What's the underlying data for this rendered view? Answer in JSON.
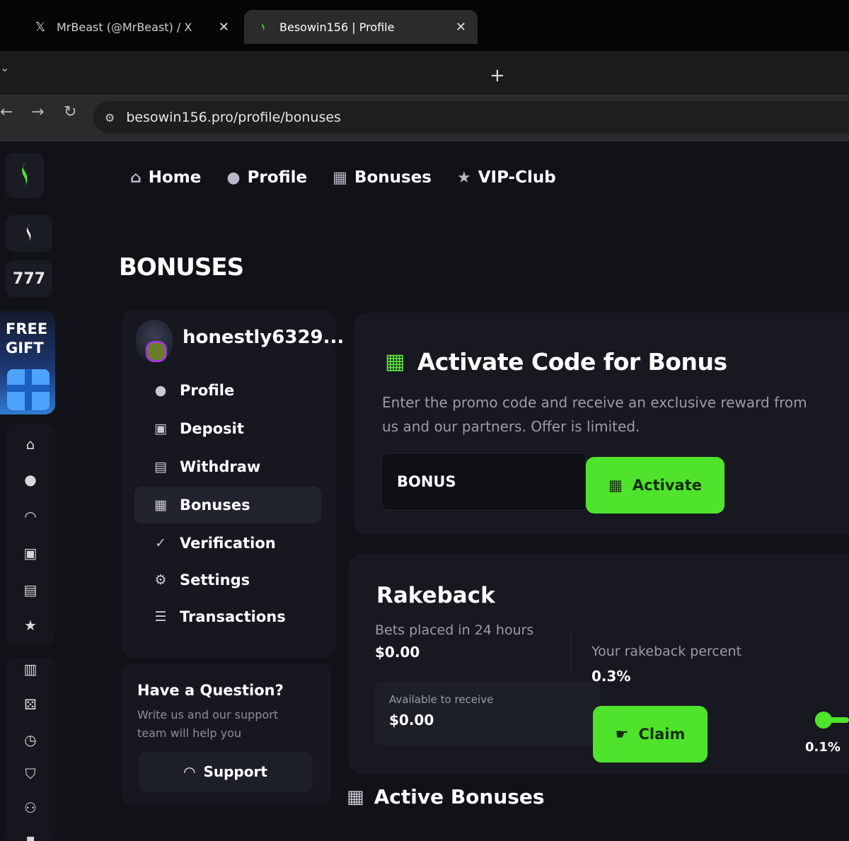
{
  "browser": {
    "tabs": [
      {
        "title": "MrBeast (@MrBeast) / X",
        "icon": "x-logo-icon"
      },
      {
        "title": "Besowin156 | Profile",
        "icon": "besowin-logo-icon"
      }
    ],
    "url": "besowin156.pro/profile/bonuses"
  },
  "rail": {
    "gift_label": "FREE GIFT",
    "slots_label": "777"
  },
  "topnav": [
    {
      "label": "Home",
      "icon": "home-icon"
    },
    {
      "label": "Profile",
      "icon": "user-icon"
    },
    {
      "label": "Bonuses",
      "icon": "gift-icon"
    },
    {
      "label": "VIP-Club",
      "icon": "star-icon"
    }
  ],
  "page_title": "BONUSES",
  "profile_menu": {
    "username": "honestly6329...",
    "items": [
      {
        "label": "Profile",
        "icon": "user-icon"
      },
      {
        "label": "Deposit",
        "icon": "wallet-icon"
      },
      {
        "label": "Withdraw",
        "icon": "wallet-out-icon"
      },
      {
        "label": "Bonuses",
        "icon": "gift-icon",
        "active": true
      },
      {
        "label": "Verification",
        "icon": "check-badge-icon"
      },
      {
        "label": "Settings",
        "icon": "gear-icon"
      },
      {
        "label": "Transactions",
        "icon": "list-icon"
      }
    ]
  },
  "help": {
    "title": "Have a Question?",
    "text": "Write us and our support team will help you",
    "button": "Support"
  },
  "activate": {
    "title": "Activate Code for Bonus",
    "description": "Enter the promo code and receive an exclusive reward from us and our partners. Offer is limited.",
    "input_value": "BONUS",
    "button": "Activate"
  },
  "rakeback": {
    "title": "Rakeback",
    "bets_label": "Bets placed in 24 hours",
    "bets_value": "$0.00",
    "percent_label": "Your rakeback percent",
    "percent_value": "0.3%",
    "available_label": "Available to receive",
    "available_value": "$0.00",
    "claim_button": "Claim",
    "slider_label": "0.1%"
  },
  "active_bonuses_title": "Active Bonuses",
  "colors": {
    "accent_green": "#4fe42b",
    "background": "#111218",
    "card": "#171820"
  }
}
